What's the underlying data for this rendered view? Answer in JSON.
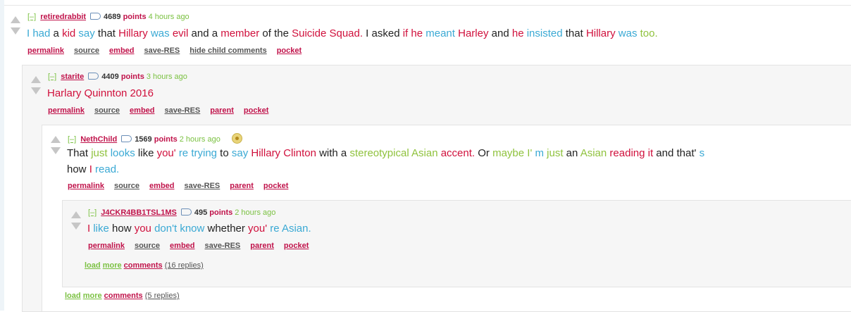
{
  "comments": [
    {
      "collapse": "[–]",
      "author": "retiredrabbit",
      "score": "4689",
      "points_label": "points",
      "time": "4 hours ago",
      "body": [
        [
          "I",
          "blue"
        ],
        [
          " ",
          ""
        ],
        [
          "had",
          "blue"
        ],
        [
          " a ",
          "dark"
        ],
        [
          "kid",
          "pink"
        ],
        [
          " ",
          ""
        ],
        [
          "say",
          "blue"
        ],
        [
          " that ",
          "dark"
        ],
        [
          "Hillary",
          "pink"
        ],
        [
          " ",
          ""
        ],
        [
          "was",
          "blue"
        ],
        [
          " ",
          ""
        ],
        [
          "evil",
          "pink"
        ],
        [
          " and a ",
          "dark"
        ],
        [
          "member",
          "pink"
        ],
        [
          " of the ",
          "dark"
        ],
        [
          "Suicide Squad.",
          "pink"
        ],
        [
          " I asked ",
          "dark"
        ],
        [
          "if",
          "pink"
        ],
        [
          " ",
          ""
        ],
        [
          "he",
          "pink"
        ],
        [
          " ",
          ""
        ],
        [
          "meant",
          "blue"
        ],
        [
          " ",
          ""
        ],
        [
          "Harley",
          "pink"
        ],
        [
          " and ",
          "dark"
        ],
        [
          "he",
          "pink"
        ],
        [
          " ",
          ""
        ],
        [
          "insisted",
          "blue"
        ],
        [
          " that ",
          "dark"
        ],
        [
          "Hillary",
          "pink"
        ],
        [
          " ",
          ""
        ],
        [
          "was",
          "blue"
        ],
        [
          " ",
          ""
        ],
        [
          "too.",
          "green"
        ]
      ],
      "buttons": [
        {
          "label": "permalink",
          "color": "pink"
        },
        {
          "label": "source",
          "color": "gray"
        },
        {
          "label": "embed",
          "color": "pink"
        },
        {
          "label": "save-RES",
          "color": "gray"
        },
        {
          "label": "hide child comments",
          "color": "gray"
        },
        {
          "label": "pocket",
          "color": "pink"
        }
      ]
    },
    {
      "collapse": "[–]",
      "author": "starite",
      "score": "4409",
      "points_label": "points",
      "time": "3 hours ago",
      "body": [
        [
          "Harlary Quinnton 2016",
          "pink"
        ]
      ],
      "buttons": [
        {
          "label": "permalink",
          "color": "pink"
        },
        {
          "label": "source",
          "color": "gray"
        },
        {
          "label": "embed",
          "color": "pink"
        },
        {
          "label": "save-RES",
          "color": "gray"
        },
        {
          "label": "parent",
          "color": "pink"
        },
        {
          "label": "pocket",
          "color": "pink"
        }
      ]
    },
    {
      "collapse": "[–]",
      "author": "NethChild",
      "score": "1569",
      "points_label": "points",
      "time": "2 hours ago",
      "body": [
        [
          "That ",
          "dark"
        ],
        [
          "just",
          "green"
        ],
        [
          " ",
          ""
        ],
        [
          "looks",
          "blue"
        ],
        [
          " like ",
          "dark"
        ],
        [
          "you'",
          "pink"
        ],
        [
          " ",
          ""
        ],
        [
          "re",
          "blue"
        ],
        [
          " ",
          ""
        ],
        [
          "trying",
          "blue"
        ],
        [
          " to ",
          "dark"
        ],
        [
          "say",
          "blue"
        ],
        [
          " ",
          ""
        ],
        [
          "Hillary Clinton",
          "pink"
        ],
        [
          " with a ",
          "dark"
        ],
        [
          "stereotypical",
          "green"
        ],
        [
          " ",
          ""
        ],
        [
          "Asian",
          "green"
        ],
        [
          " ",
          ""
        ],
        [
          "accent.",
          "pink"
        ],
        [
          " Or ",
          "dark"
        ],
        [
          "maybe",
          "green"
        ],
        [
          " ",
          ""
        ],
        [
          "I'",
          "green"
        ],
        [
          " ",
          ""
        ],
        [
          "m",
          "blue"
        ],
        [
          " ",
          ""
        ],
        [
          "just",
          "green"
        ],
        [
          " an ",
          "dark"
        ],
        [
          "Asian",
          "green"
        ],
        [
          " ",
          ""
        ],
        [
          "reading",
          "pink"
        ],
        [
          " ",
          ""
        ],
        [
          "it",
          "pink"
        ],
        [
          " and that'",
          "dark"
        ],
        [
          " ",
          ""
        ],
        [
          "s",
          "blue"
        ],
        [
          " how ",
          "dark"
        ],
        [
          "I",
          "pink"
        ],
        [
          " ",
          ""
        ],
        [
          "read.",
          "blue"
        ]
      ],
      "buttons": [
        {
          "label": "permalink",
          "color": "pink"
        },
        {
          "label": "source",
          "color": "gray"
        },
        {
          "label": "embed",
          "color": "pink"
        },
        {
          "label": "save-RES",
          "color": "gray"
        },
        {
          "label": "parent",
          "color": "pink"
        },
        {
          "label": "pocket",
          "color": "pink"
        }
      ]
    },
    {
      "collapse": "[–]",
      "author": "J4CKR4BB1TSL1MS",
      "score": "495",
      "points_label": "points",
      "time": "2 hours ago",
      "body": [
        [
          "I",
          "pink"
        ],
        [
          " ",
          ""
        ],
        [
          "like",
          "blue"
        ],
        [
          " how ",
          "dark"
        ],
        [
          "you",
          "pink"
        ],
        [
          " ",
          ""
        ],
        [
          "don't",
          "blue"
        ],
        [
          " ",
          ""
        ],
        [
          "know",
          "blue"
        ],
        [
          " whether ",
          "dark"
        ],
        [
          "you'",
          "pink"
        ],
        [
          " ",
          ""
        ],
        [
          "re",
          "blue"
        ],
        [
          " ",
          ""
        ],
        [
          "Asian.",
          "blue"
        ]
      ],
      "buttons": [
        {
          "label": "permalink",
          "color": "pink"
        },
        {
          "label": "source",
          "color": "gray"
        },
        {
          "label": "embed",
          "color": "pink"
        },
        {
          "label": "save-RES",
          "color": "gray"
        },
        {
          "label": "parent",
          "color": "pink"
        },
        {
          "label": "pocket",
          "color": "pink"
        }
      ]
    }
  ],
  "load_more_inner": {
    "load": "load",
    "more": "more",
    "comments": "comments",
    "count": "(16 replies)"
  },
  "load_more_outer": {
    "load": "load",
    "more": "more",
    "comments": "comments",
    "count": "(5 replies)"
  }
}
